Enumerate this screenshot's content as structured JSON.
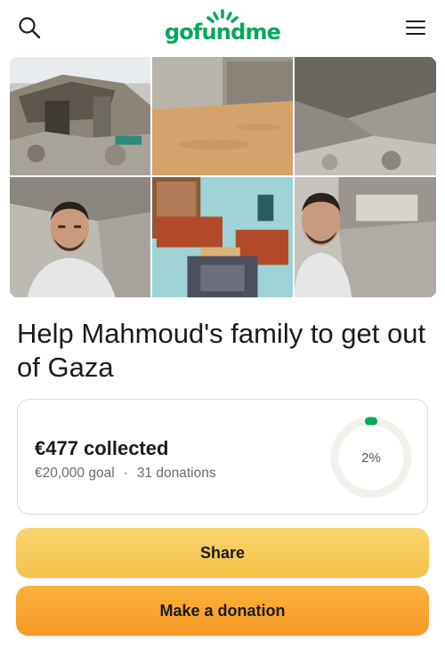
{
  "header": {
    "logo_text": "gofundme",
    "search_icon": "search-icon",
    "menu_icon": "hamburger-menu-icon",
    "brand_color": "#02a95c"
  },
  "photos": [
    "rubble-building-photo",
    "tent-on-sand-photo",
    "collapsed-concrete-photo",
    "selfie-in-rubble-photo",
    "living-room-photo",
    "selfie-destroyed-building-photo"
  ],
  "campaign": {
    "title": "Help Mahmoud's family to get out of Gaza"
  },
  "progress": {
    "collected": "€477 collected",
    "goal": "€20,000 goal",
    "separator": "·",
    "donations": "31 donations",
    "percent_label": "2%",
    "percent_value": 0.02,
    "ring_color": "#02a95c"
  },
  "actions": {
    "share_label": "Share",
    "donate_label": "Make a donation"
  }
}
